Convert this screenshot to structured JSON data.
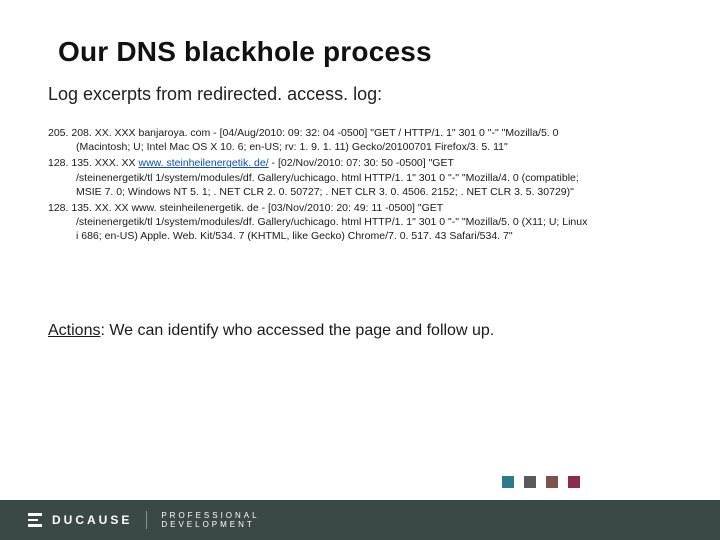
{
  "title": "Our DNS blackhole process",
  "subtitle": "Log excerpts from redirected. access. log:",
  "logs": [
    {
      "line1_pre": "205. 208. XX. XXX banjaroya. com - [04/Aug/2010: 09: 32: 04 -0500] \"GET / HTTP/1. 1\" 301 0 \"-\" \"Mozilla/5. 0",
      "line2": "(Macintosh; U; Intel Mac OS X 10. 6; en-US; rv: 1. 9. 1. 11) Gecko/20100701 Firefox/3. 5. 11\""
    },
    {
      "line1_pre": "128. 135. XXX. XX ",
      "link_text": "www. steinheilenergetik. de/",
      "line1_post": " - [02/Nov/2010: 07: 30: 50 -0500] \"GET",
      "line2": "/steinenergetik/tl 1/system/modules/df. Gallery/uchicago. html HTTP/1. 1\" 301 0 \"-\" \"Mozilla/4. 0 (compatible;",
      "line3": "MSIE 7. 0; Windows NT 5. 1; . NET CLR 2. 0. 50727; . NET CLR 3. 0. 4506. 2152; . NET CLR 3. 5. 30729)\""
    },
    {
      "line1_pre": "128. 135. XX. XX www. steinheilenergetik. de - [03/Nov/2010: 20: 49: 11 -0500] \"GET",
      "line2": "/steinenergetik/tl 1/system/modules/df. Gallery/uchicago. html HTTP/1. 1\" 301 0 \"-\" \"Mozilla/5. 0 (X11; U; Linux",
      "line3": "i 686; en-US) Apple. Web. Kit/534. 7 (KHTML, like Gecko) Chrome/7. 0. 517. 43 Safari/534. 7\""
    }
  ],
  "actions": {
    "label": "Actions",
    "text": ": We can identify who accessed the page and follow up."
  },
  "footer": {
    "brand": "DUCAUSE",
    "subbrand_line1": "PROFESSIONAL",
    "subbrand_line2": "DEVELOPMENT"
  },
  "colors": {
    "sq1": "#2d7a8c",
    "sq2": "#5a5a5a",
    "sq3": "#7e534d",
    "sq4": "#8e2b4c",
    "footer_bg": "#3a4848"
  }
}
